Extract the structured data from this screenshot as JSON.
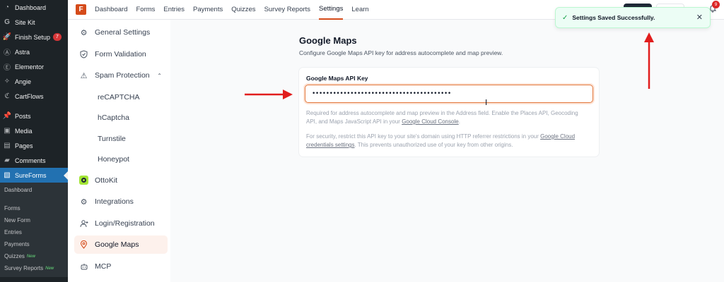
{
  "wp_sidebar": {
    "items": [
      {
        "label": "Dashboard",
        "icon": "dashboard-icon"
      },
      {
        "label": "Site Kit",
        "icon": "sitekit-icon"
      },
      {
        "label": "Finish Setup",
        "icon": "rocket-icon",
        "badge": "7"
      },
      {
        "label": "Astra",
        "icon": "astra-icon"
      },
      {
        "label": "Elementor",
        "icon": "elementor-icon"
      },
      {
        "label": "Angie",
        "icon": "angie-icon"
      },
      {
        "label": "CartFlows",
        "icon": "cartflows-icon"
      },
      {
        "label": "Posts",
        "icon": "pin-icon"
      },
      {
        "label": "Media",
        "icon": "media-icon"
      },
      {
        "label": "Pages",
        "icon": "pages-icon"
      },
      {
        "label": "Comments",
        "icon": "comment-icon"
      },
      {
        "label": "SureForms",
        "icon": "sureforms-icon"
      }
    ],
    "submenu": [
      {
        "label": "Dashboard"
      },
      {
        "label": "Forms"
      },
      {
        "label": "New Form"
      },
      {
        "label": "Entries"
      },
      {
        "label": "Payments"
      },
      {
        "label": "Quizzes",
        "tag": "New"
      },
      {
        "label": "Survey Reports",
        "tag": "New"
      }
    ]
  },
  "topnav": {
    "links": [
      "Dashboard",
      "Forms",
      "Entries",
      "Payments",
      "Quizzes",
      "Survey Reports",
      "Settings",
      "Learn"
    ],
    "logo_letter": "F",
    "notification_count": "9"
  },
  "settings_nav": {
    "general": "General Settings",
    "form_validation": "Form Validation",
    "spam_protection": "Spam Protection",
    "spam_sub": [
      "reCAPTCHA",
      "hCaptcha",
      "Turnstile",
      "Honeypot"
    ],
    "ottokit": "OttoKit",
    "integrations": "Integrations",
    "login": "Login/Registration",
    "google_maps": "Google Maps",
    "mcp": "MCP"
  },
  "main": {
    "title": "Google Maps",
    "description": "Configure Google Maps API key for address autocomplete and map preview.",
    "field_label": "Google Maps API Key",
    "field_value": "••••••••••••••••••••••••••••••••••••••••",
    "help1_pre": "Required for address autocomplete and map preview in the Address field. Enable the Places API, Geocoding API, and Maps JavaScript API in your ",
    "help1_link": "Google Cloud Console",
    "help1_post": ".",
    "help2_pre": "For security, restrict this API key to your site's domain using HTTP referrer restrictions in your ",
    "help2_link": "Google Cloud credentials settings",
    "help2_post": ". This prevents unauthorized use of your key from other origins."
  },
  "toast": {
    "message": "Settings Saved Successfully.",
    "close": "✕"
  },
  "colors": {
    "brand": "#d54b1a",
    "wp_sidebar": "#1d2327",
    "wp_active": "#2271b1",
    "arrow": "#e11d1d"
  }
}
